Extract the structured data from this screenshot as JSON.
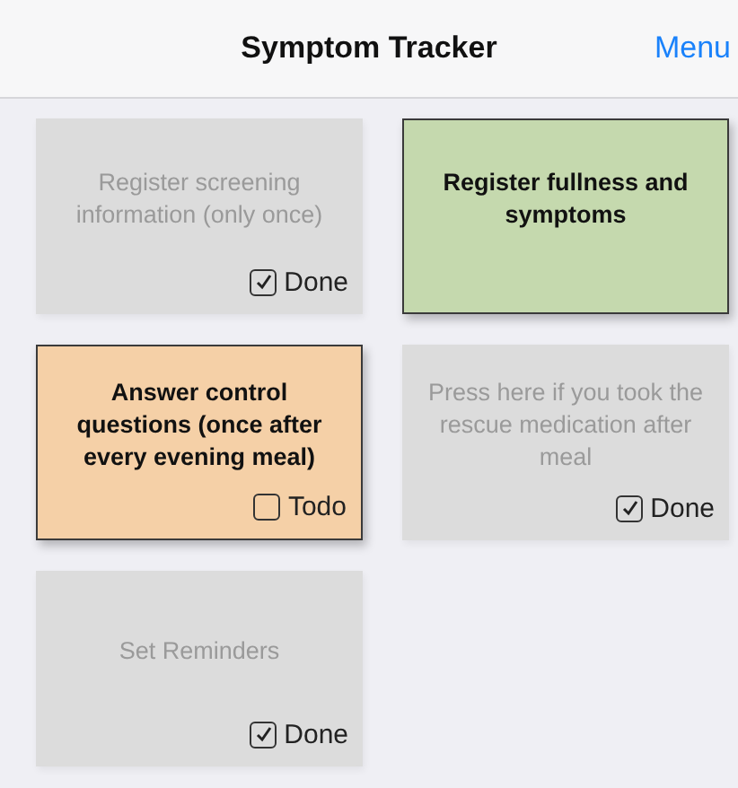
{
  "header": {
    "title": "Symptom Tracker",
    "menu": "Menu"
  },
  "tiles": [
    {
      "text": "Register screening information (only once)",
      "active": false,
      "color": "#dcdcdc",
      "status": {
        "checked": true,
        "label": "Done"
      }
    },
    {
      "text": "Register fullness and symptoms",
      "active": true,
      "color": "#c5d9ae"
    },
    {
      "text": "Answer control questions (once after every evening meal)",
      "active": true,
      "color": "#f5d0a7",
      "status": {
        "checked": false,
        "label": "Todo"
      }
    },
    {
      "text": "Press here if you took the rescue medication after meal",
      "active": false,
      "color": "#dcdcdc",
      "status": {
        "checked": true,
        "label": "Done"
      }
    },
    {
      "text": "Set Reminders",
      "active": false,
      "color": "#dcdcdc",
      "status": {
        "checked": true,
        "label": "Done"
      }
    }
  ]
}
